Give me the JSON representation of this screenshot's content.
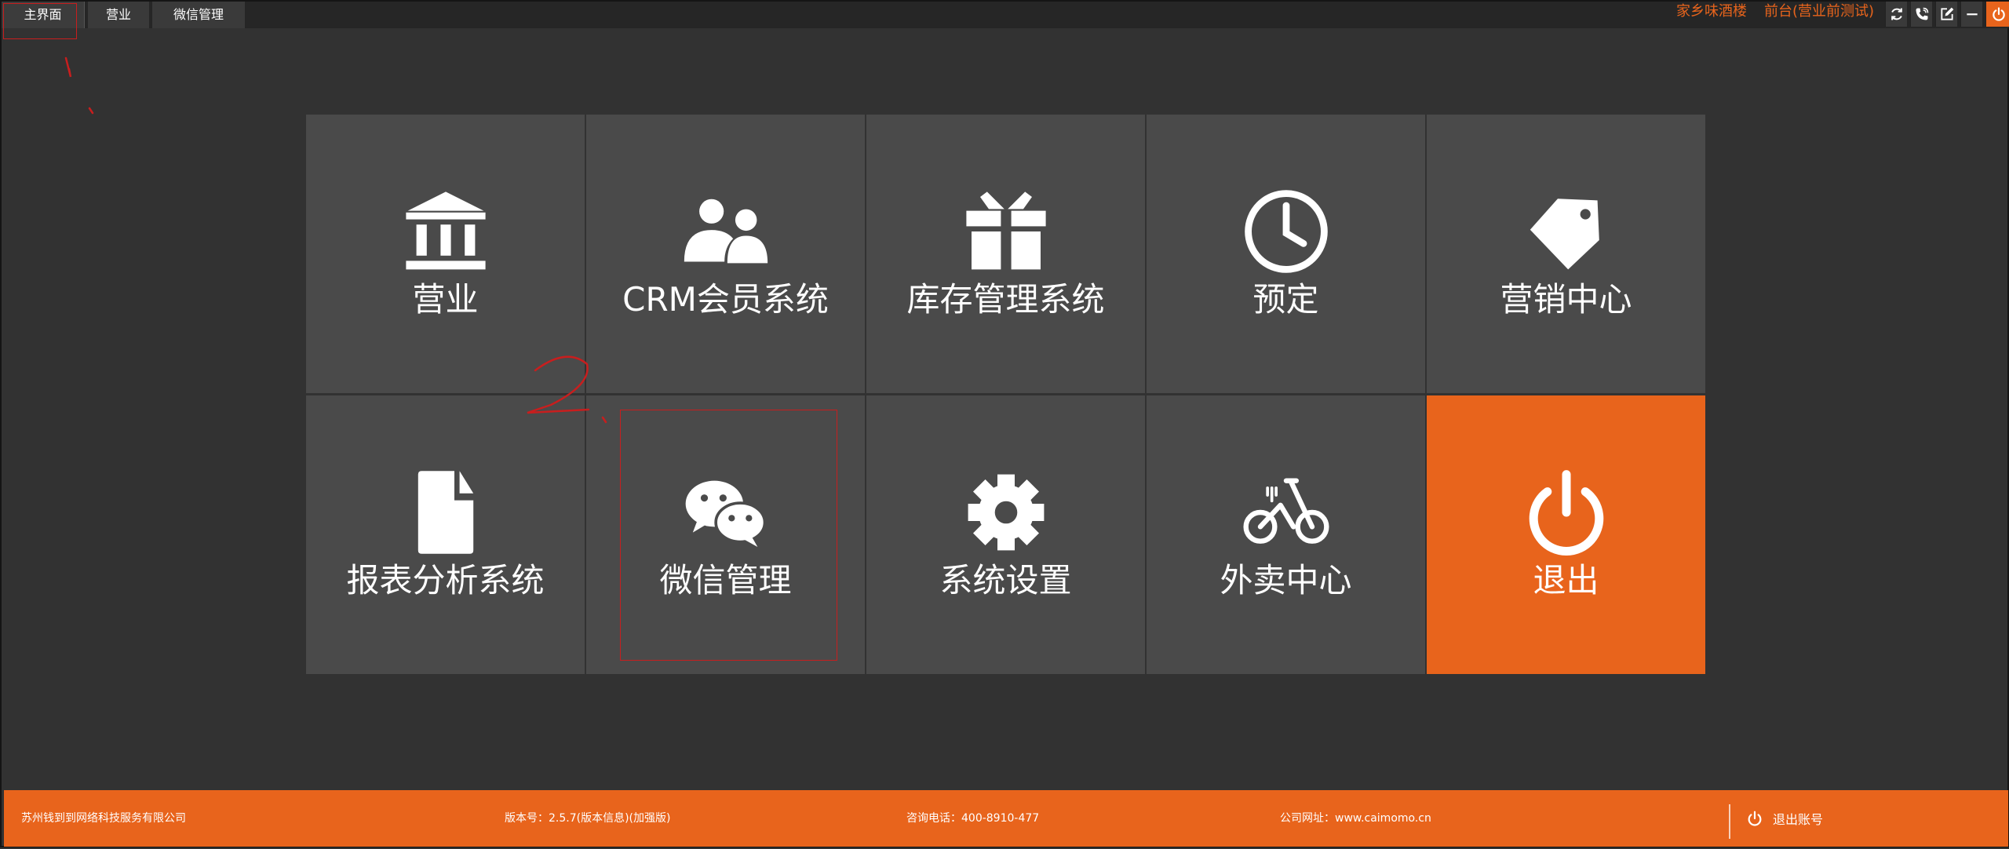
{
  "topbar": {
    "tabs": [
      "主界面",
      "营业",
      "微信管理"
    ],
    "store_name": "家乡味酒楼",
    "store_role": "前台(营业前测试)",
    "controls": [
      "refresh-icon",
      "phone-icon",
      "edit-icon",
      "minimize-icon",
      "power-icon"
    ]
  },
  "tiles": [
    {
      "label": "营业",
      "icon": "bank-icon"
    },
    {
      "label": "CRM会员系统",
      "icon": "users-icon"
    },
    {
      "label": "库存管理系统",
      "icon": "gift-icon"
    },
    {
      "label": "预定",
      "icon": "clock-icon"
    },
    {
      "label": "营销中心",
      "icon": "tag-icon"
    },
    {
      "label": "报表分析系统",
      "icon": "document-icon"
    },
    {
      "label": "微信管理",
      "icon": "wechat-icon"
    },
    {
      "label": "系统设置",
      "icon": "gear-icon"
    },
    {
      "label": "外卖中心",
      "icon": "bicycle-icon"
    },
    {
      "label": "退出",
      "icon": "power-icon"
    }
  ],
  "annotations": {
    "mark_1": "1.",
    "mark_2": "2."
  },
  "footer": {
    "company": "苏州钱到到网络科技服务有限公司",
    "version": "版本号：2.5.7(版本信息)(加强版)",
    "phone": "咨询电话：400-8910-477",
    "site": "公司网址：www.caimomo.cn",
    "logout_label": "退出账号"
  },
  "colors": {
    "accent": "#e8641c",
    "tile": "#4a4a4a",
    "background": "#323232",
    "annotation": "#c81e1e"
  }
}
